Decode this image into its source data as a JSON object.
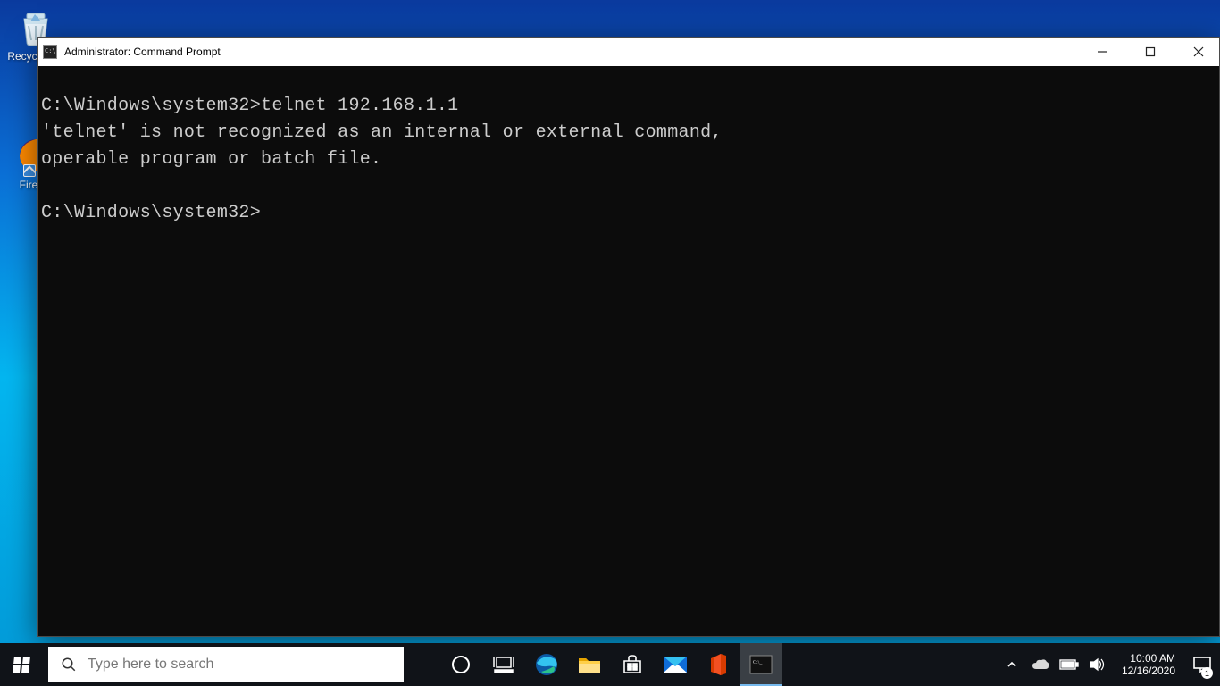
{
  "desktop": {
    "recycle_bin_label": "Recycle Bin",
    "firefox_label": "Firefox"
  },
  "window": {
    "title": "Administrator: Command Prompt"
  },
  "terminal": {
    "line1": "C:\\Windows\\system32>telnet 192.168.1.1",
    "line2": "'telnet' is not recognized as an internal or external command,",
    "line3": "operable program or batch file.",
    "line4": "",
    "line5": "C:\\Windows\\system32>"
  },
  "taskbar": {
    "search_placeholder": "Type here to search"
  },
  "tray": {
    "time": "10:00 AM",
    "date": "12/16/2020",
    "notifications": "1"
  }
}
